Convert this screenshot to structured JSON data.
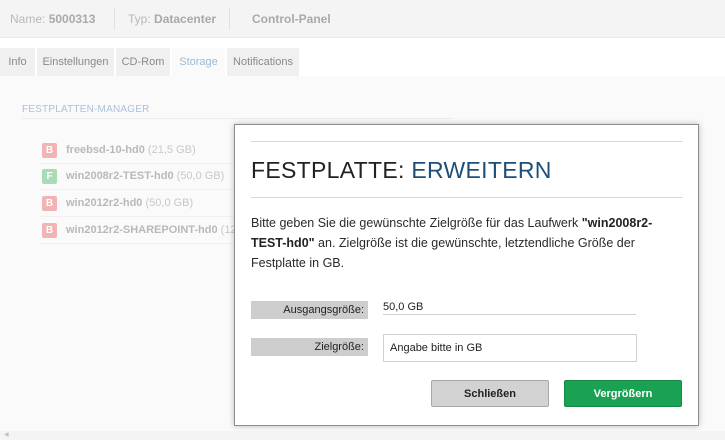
{
  "infobar": {
    "name_label": "Name:",
    "name_value": "5000313",
    "type_label": "Typ:",
    "type_value": "Datacenter",
    "panel": "Control-Panel"
  },
  "tabs": [
    {
      "label": "Info"
    },
    {
      "label": "Einstellungen"
    },
    {
      "label": "CD-Rom"
    },
    {
      "label": "Storage",
      "active": true
    },
    {
      "label": "Notifications"
    }
  ],
  "section": {
    "title": "FESTPLATTEN-MANAGER"
  },
  "disks": [
    {
      "badge": "B",
      "name": "freebsd-10-hd0",
      "size": "(21,5 GB)"
    },
    {
      "badge": "F",
      "name": "win2008r2-TEST-hd0",
      "size": "(50,0 GB)"
    },
    {
      "badge": "B",
      "name": "win2012r2-hd0",
      "size": "(50,0 GB)"
    },
    {
      "badge": "B",
      "name": "win2012r2-SHAREPOINT-hd0",
      "size": "(12"
    }
  ],
  "modal": {
    "title_prefix": "FESTPLATTE:",
    "title_accent": "ERWEITERN",
    "text_before": "Bitte geben Sie die gewünschte Zielgröße für das Laufwerk ",
    "text_drive": "\"win2008r2-TEST-hd0\"",
    "text_after": " an. Zielgröße ist die gewünschte, letztendliche Größe der Festplatte in GB.",
    "source_label": "Ausgangsgröße:",
    "source_value": "50,0 GB",
    "target_label": "Zielgröße:",
    "target_placeholder": "Angabe bitte in GB",
    "close_label": "Schließen",
    "grow_label": "Vergrößern"
  },
  "colors": {
    "accent": "#1f4e79",
    "success": "#1aa153",
    "badge_b": "#f1b3b3",
    "badge_f": "#a8dcb6"
  }
}
